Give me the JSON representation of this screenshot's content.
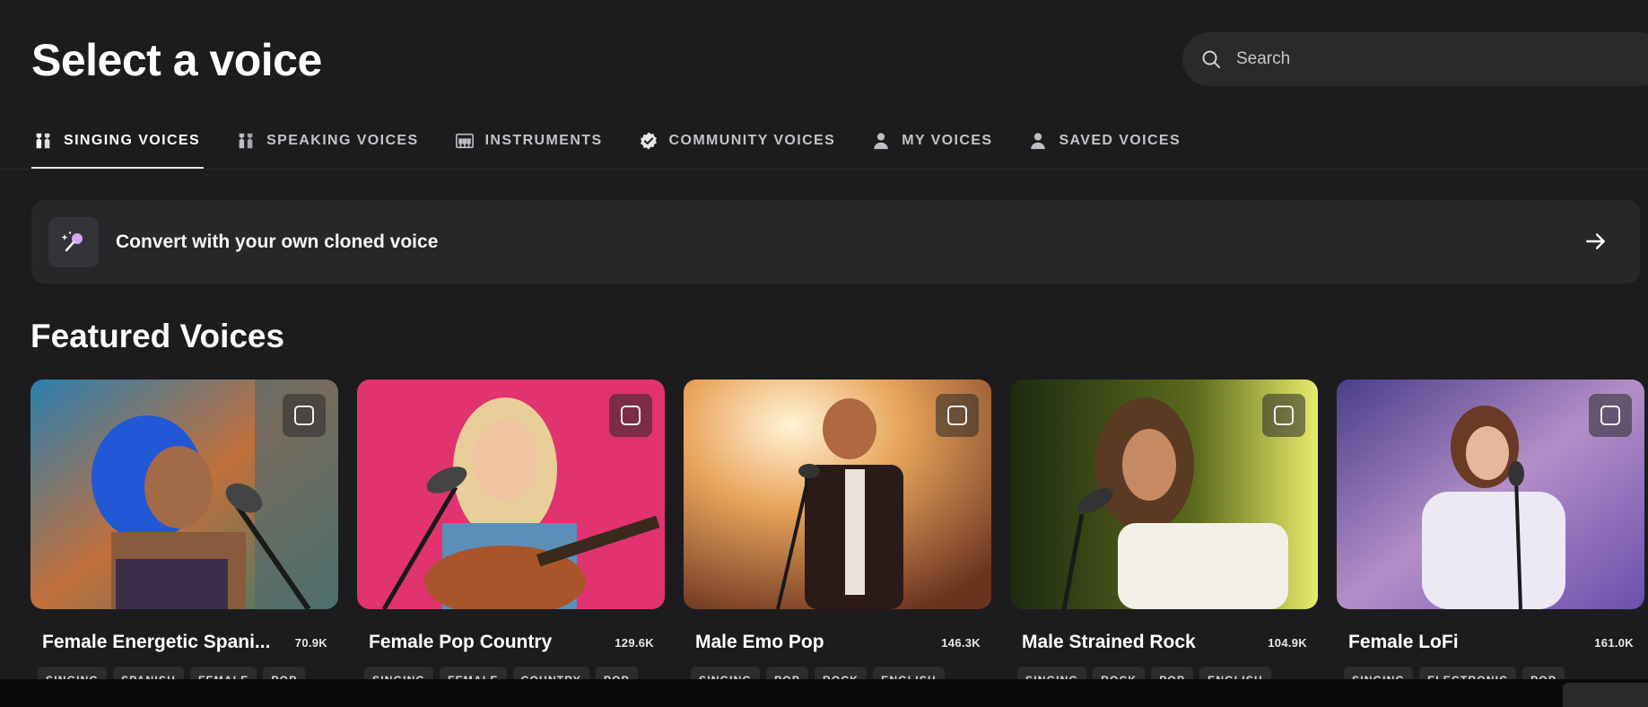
{
  "header": {
    "title": "Select a voice",
    "search_placeholder": "Search"
  },
  "tabs": [
    {
      "label": "SINGING VOICES",
      "icon": "singing-voices-icon",
      "active": true
    },
    {
      "label": "SPEAKING VOICES",
      "icon": "speaking-voices-icon",
      "active": false
    },
    {
      "label": "INSTRUMENTS",
      "icon": "piano-icon",
      "active": false
    },
    {
      "label": "COMMUNITY VOICES",
      "icon": "verified-badge-icon",
      "active": false
    },
    {
      "label": "MY VOICES",
      "icon": "person-icon",
      "active": false
    },
    {
      "label": "SAVED VOICES",
      "icon": "person-icon",
      "active": false
    }
  ],
  "clone_banner": {
    "label": "Convert with your own cloned voice",
    "icon": "microphone-sparkle-icon",
    "arrow_icon": "arrow-right-icon"
  },
  "featured": {
    "title": "Featured Voices",
    "cards": [
      {
        "name": "Female Energetic Spani...",
        "count": "70.9K",
        "tags": [
          "SINGING",
          "SPANISH",
          "FEMALE",
          "POP"
        ]
      },
      {
        "name": "Female Pop Country",
        "count": "129.6K",
        "tags": [
          "SINGING",
          "FEMALE",
          "COUNTRY",
          "POP"
        ]
      },
      {
        "name": "Male Emo Pop",
        "count": "146.3K",
        "tags": [
          "SINGING",
          "POP",
          "ROCK",
          "ENGLISH"
        ]
      },
      {
        "name": "Male Strained Rock",
        "count": "104.9K",
        "tags": [
          "SINGING",
          "ROCK",
          "POP",
          "ENGLISH"
        ]
      },
      {
        "name": "Female LoFi",
        "count": "161.0K",
        "tags": [
          "SINGING",
          "ELECTRONIC",
          "POP"
        ]
      }
    ]
  },
  "colors": {
    "background": "#1c1c1e",
    "surface": "#272729",
    "text": "#ffffff",
    "accent_clone_icon": "#d9a6f2"
  }
}
